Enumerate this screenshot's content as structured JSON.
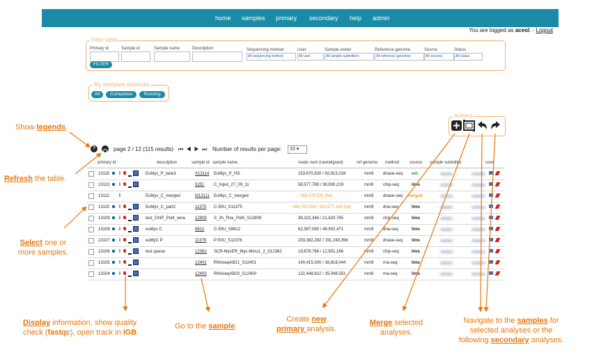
{
  "nav": {
    "items": [
      "home",
      "samples",
      "primary",
      "secondary",
      "help",
      "admin"
    ],
    "login_prefix": "You are logged as",
    "user": "aceol",
    "logout": "Logout"
  },
  "filter": {
    "legend": "Filter table",
    "fields": {
      "primary_id": "Primary id",
      "sample_id": "Sample id",
      "sample_name": "Sample name",
      "description": "Description",
      "seq_method": "Sequencing method",
      "user": "User",
      "sample_owner": "Sample owner",
      "ref_genome": "Reference genome",
      "source": "Source",
      "status": "Status"
    },
    "selects": {
      "seq_method": "All sequencing method",
      "user": "All user",
      "sample_owner": "All sample submitters",
      "ref_genome": "All reference genomes",
      "source": "All sources",
      "status": "All status"
    },
    "button": "FILTER"
  },
  "shortcuts": {
    "legend": "My analyses shortcuts",
    "buttons": [
      "All",
      "Completed",
      "Running"
    ]
  },
  "actions": {
    "legend": "Actions",
    "icons": [
      "new-analysis-icon",
      "merge-icon",
      "back-to-samples-icon",
      "forward-secondary-icon"
    ]
  },
  "pagination": {
    "text": "page 2 / 12 (115 results)",
    "per_page_label": "Number of results per page:",
    "per_page": "10"
  },
  "table": {
    "headers": [
      "primary id",
      "description",
      "sample id",
      "sample name",
      "reads num (raw/aligned)",
      "ref genome",
      "method",
      "source",
      "sample submitter",
      "user"
    ],
    "rows": [
      {
        "pid": "13115",
        "desc": "EuMyc_P_lane3",
        "sid": "X13114",
        "sname": "EuMyc_P_HD",
        "reads": "153,670,520 / 92,913,234",
        "genome": "mm9",
        "method": "dnase-seq",
        "source": "ext.",
        "reads_color": "#222",
        "source_color": "#2e8a2e"
      },
      {
        "pid": "13113",
        "desc": "",
        "sid": "5251",
        "sname": "C_Input_27_09_11",
        "reads": "58,577,789 / 38,930,219",
        "genome": "mm9",
        "method": "chip-seq",
        "source": "lims",
        "reads_color": "#222",
        "source_color": "#222"
      },
      {
        "pid": "13112",
        "desc": "EuMyc_C_merged",
        "sid": "M13111",
        "sname": "EuMyc_C_merged",
        "reads": "/ 365,570,520 (hd)",
        "genome": "mm9",
        "method": "dnase-seq",
        "source": "merged",
        "reads_color": "#e8a020",
        "source_color": "#e8a020"
      },
      {
        "pid": "13110",
        "desc": "EuMyc_C_part2",
        "sid": "11375",
        "sname": "C-50U_S11375",
        "reads": "384,702,008 / 315,677,140 (hd)",
        "genome": "mm9",
        "method": "dna-seq",
        "source": "lims",
        "reads_color": "#e8a020",
        "source_color": "#222"
      },
      {
        "pid": "13109",
        "desc": "test_ChIP_PolII_vera",
        "sid": "12909",
        "sname": "S_2h_Flox_PolII_S12909",
        "reads": "39,322,346 / 21,620,765",
        "genome": "mm9",
        "method": "chip-seq",
        "source": "lims",
        "reads_color": "#222",
        "source_color": "#222"
      },
      {
        "pid": "13108",
        "desc": "euMyc C",
        "sid": "9812",
        "sname": "C-50U_S9812",
        "reads": "62,587,090 / 49,902,471",
        "genome": "mm9",
        "method": "dna-seq",
        "source": "lims",
        "reads_color": "#222",
        "source_color": "#222"
      },
      {
        "pid": "13107",
        "desc": "euMyC P",
        "sid": "11376",
        "sname": "P-50U_S11376",
        "reads": "233,382,282 / 191,240,396",
        "genome": "mm9",
        "method": "dnase-seq",
        "source": "lims",
        "reads_color": "#222",
        "source_color": "#222"
      },
      {
        "pid": "13106",
        "desc": "test queue",
        "sid": "12362",
        "sname": "SCR-MycER_Myc-Mmu1_2_S12362",
        "reads": "19,678,766 / 12,501,166",
        "genome": "mm9",
        "method": "chip-seq",
        "source": "lims",
        "reads_color": "#222",
        "source_color": "#222"
      },
      {
        "pid": "13105",
        "desc": "",
        "sid": "12401",
        "sname": "RNAseqAB21_S12401",
        "reads": "140,415,000 / 38,818,044",
        "genome": "mm9",
        "method": "rna-seq",
        "source": "lims",
        "reads_color": "#222",
        "source_color": "#222"
      },
      {
        "pid": "13104",
        "desc": "",
        "sid": "12400",
        "sname": "RNAseqAB20_S12400",
        "reads": "122,448,612 / 35,048,551",
        "genome": "mm9",
        "method": "rna-seq",
        "source": "lims",
        "reads_color": "#222",
        "source_color": "#222"
      }
    ]
  },
  "annotations": {
    "legends": {
      "pre": "Show ",
      "link": "legends",
      "post": "."
    },
    "refresh": {
      "link": "Refresh",
      "post": " the table."
    },
    "select": {
      "link": "Select",
      "post": " one or",
      "line2": "more samples."
    },
    "display": {
      "link": "Display",
      "post": " information, show quality",
      "line2_pre": "check (",
      "line2_b": "fastqc",
      "line2_mid": "), open track in ",
      "line2_b2": "IGB",
      "line2_post": "."
    },
    "goto": {
      "pre": "Go to the ",
      "link": "sample",
      "post": "."
    },
    "create": {
      "pre": "Create ",
      "link": "new",
      "line2_link": "primary ",
      "line2_post": "analysis."
    },
    "merge": {
      "link": "Merge",
      "post": " selected",
      "line2": "analyses."
    },
    "navigate": {
      "pre": "Navigate to the ",
      "link": "samples",
      "post": " for",
      "line2": "selected analyses or the",
      "line3_pre": "following ",
      "line3_link": "secondary",
      "line3_post": " analyses."
    }
  },
  "colors": {
    "navbar": "#1a8aa6",
    "accent": "#e8750a",
    "legend": "#f5b06a",
    "link": "#1a5fa8"
  }
}
